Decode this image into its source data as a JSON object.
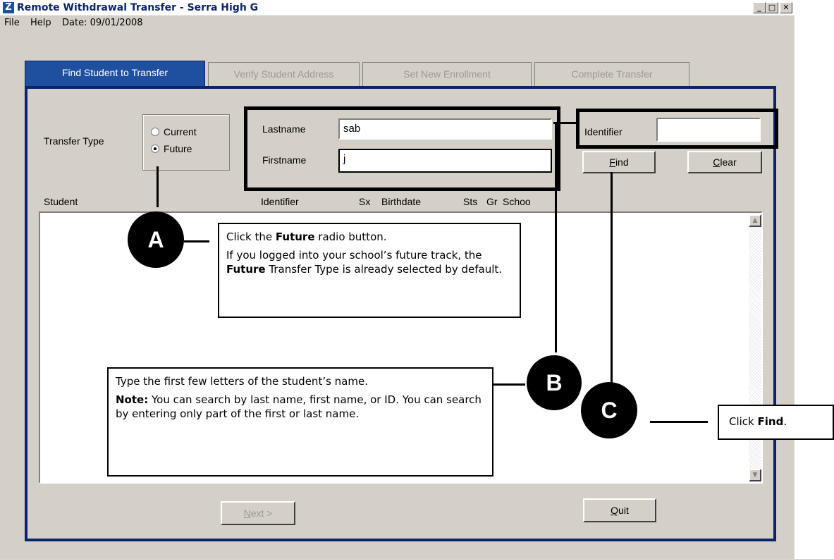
{
  "window": {
    "title": "Remote Withdrawal Transfer - Serra High G",
    "app_icon": "Z",
    "controls": {
      "minimize": "_",
      "maximize": "□",
      "close": "✕"
    }
  },
  "menu": {
    "file": "File",
    "help": "Help",
    "date": "Date: 09/01/2008"
  },
  "tabs": [
    {
      "label": "Find Student to Transfer",
      "active": true
    },
    {
      "label": "Verify Student Address",
      "active": false
    },
    {
      "label": "Set New Enrollment",
      "active": false
    },
    {
      "label": "Complete Transfer",
      "active": false
    }
  ],
  "form": {
    "transfer_type_label": "Transfer Type",
    "radio_current": "Current",
    "radio_future": "Future",
    "selected_type": "Future",
    "lastname_label": "Lastname",
    "lastname_value": "sab",
    "firstname_label": "Firstname",
    "firstname_value": "j",
    "identifier_label": "Identifier",
    "identifier_value": "",
    "find_button": "Find",
    "clear_button": "Clear"
  },
  "list": {
    "columns": [
      "Student",
      "Identifier",
      "Sx",
      "Birthdate",
      "Sts",
      "Gr",
      "Schoo"
    ],
    "rows": []
  },
  "footer": {
    "next_button": "Next >",
    "quit_button": "Quit"
  },
  "annotations": {
    "a": {
      "marker": "A",
      "line1_pre": "Click the ",
      "line1_bold": "Future",
      "line1_post": " radio button.",
      "line2_pre": "If you logged into your school’s future track, the ",
      "line2_bold": "Future",
      "line2_post": " Transfer Type is already selected by default."
    },
    "b": {
      "marker": "B",
      "line1": "Type the first few letters of the student’s name.",
      "note_label": "Note:",
      "note_text": " You can search by last name, first name, or ID. You can search by entering only part of the first or last name."
    },
    "c": {
      "marker": "C",
      "pre": "Click ",
      "bold": "Find",
      "post": "."
    }
  }
}
